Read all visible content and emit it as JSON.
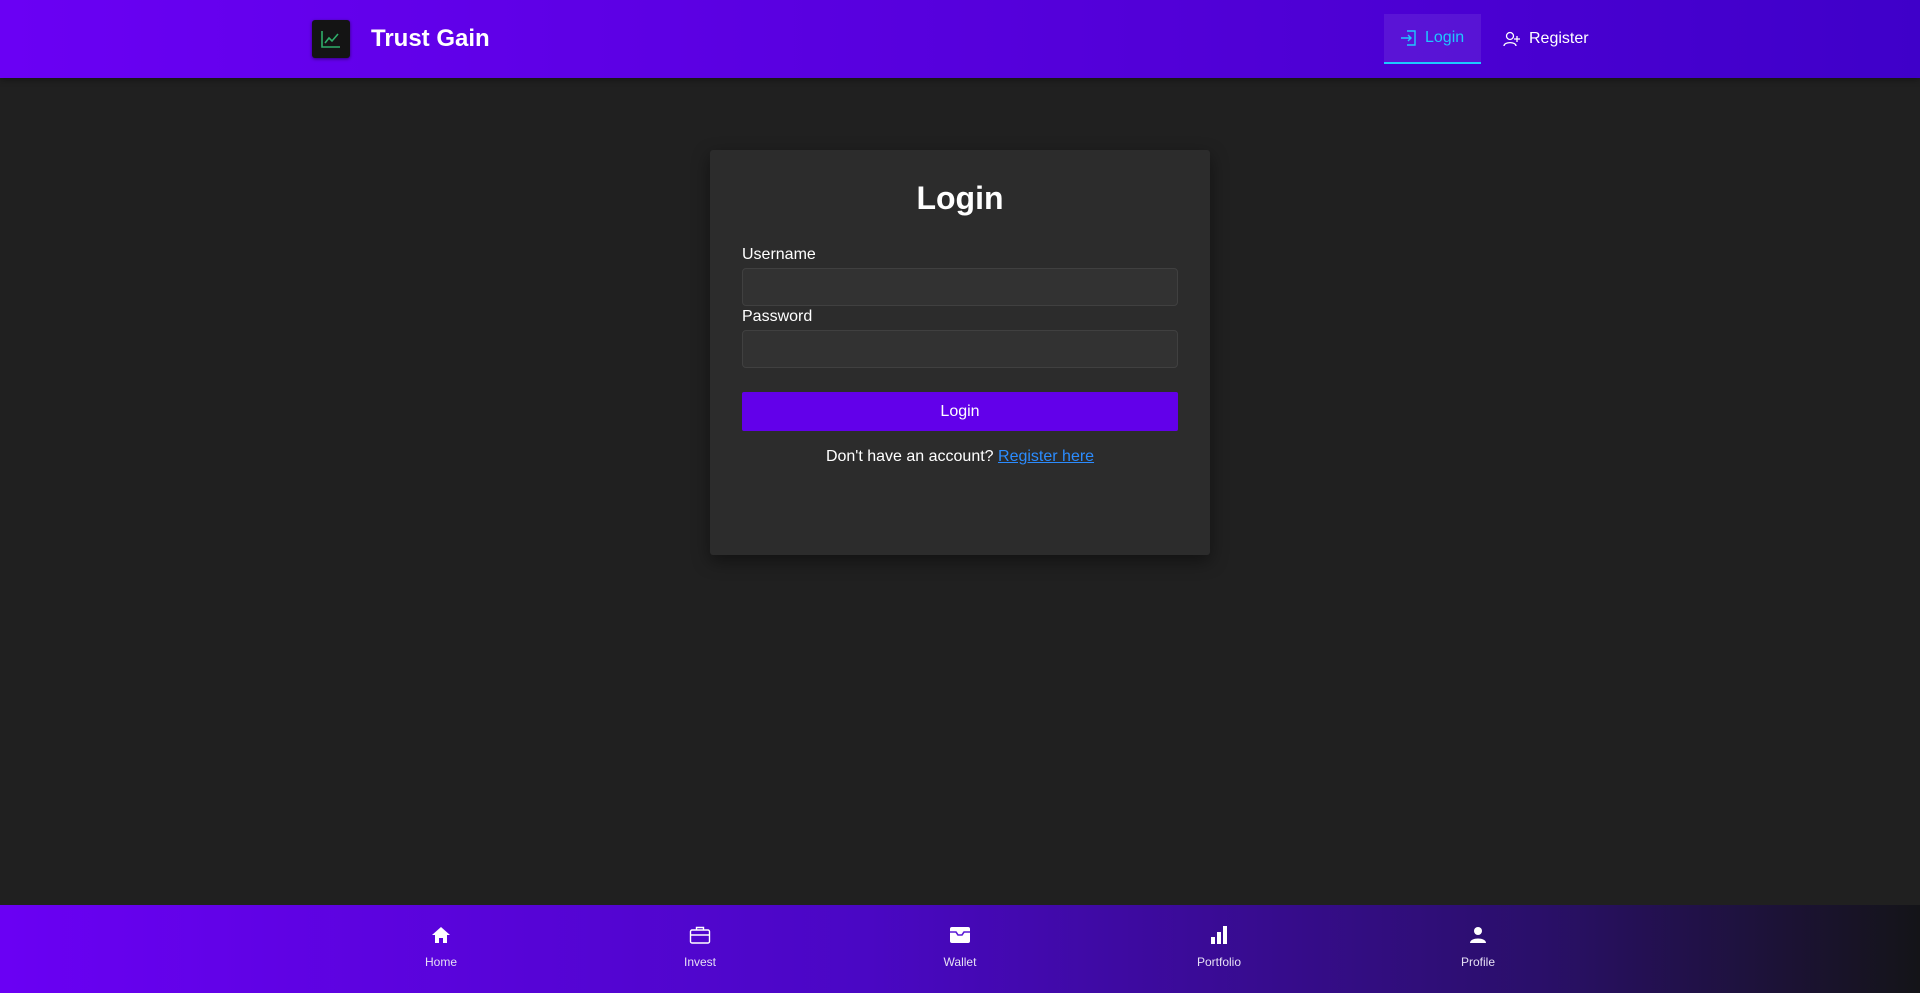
{
  "brand": {
    "name": "Trust Gain",
    "logo_icon": "chart-line-icon"
  },
  "nav": {
    "login": {
      "label": "Login",
      "icon": "login-icon",
      "active": true
    },
    "register": {
      "label": "Register",
      "icon": "user-plus-icon"
    }
  },
  "login_card": {
    "title": "Login",
    "username_label": "Username",
    "username_value": "",
    "password_label": "Password",
    "password_value": "",
    "submit_label": "Login",
    "no_account_text": "Don't have an account?",
    "register_link": "Register here"
  },
  "bottom_nav": [
    {
      "label": "Home",
      "icon": "home-icon"
    },
    {
      "label": "Invest",
      "icon": "briefcase-icon"
    },
    {
      "label": "Wallet",
      "icon": "wallet-icon"
    },
    {
      "label": "Portfolio",
      "icon": "bar-chart-icon"
    },
    {
      "label": "Profile",
      "icon": "person-icon"
    }
  ],
  "colors": {
    "accent": "#6200ea",
    "active_link": "#1ec8ff",
    "link": "#2b8cff",
    "background": "#202020",
    "card": "#2c2c2c"
  }
}
